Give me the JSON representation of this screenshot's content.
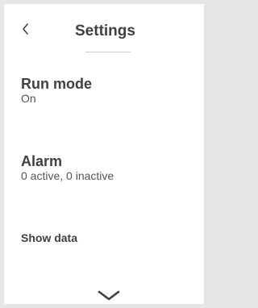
{
  "header": {
    "title": "Settings",
    "back_icon": "chevron-left-icon"
  },
  "items": [
    {
      "label": "Run mode",
      "value": "On"
    },
    {
      "label": "Alarm",
      "value": "0 active, 0 inactive"
    }
  ],
  "show_data_label": "Show data",
  "scroll_icon": "chevron-down-icon",
  "colors": {
    "background": "#ffffff",
    "frame": "#e6e6e6",
    "text_primary": "#404040",
    "text_secondary": "#555555"
  }
}
